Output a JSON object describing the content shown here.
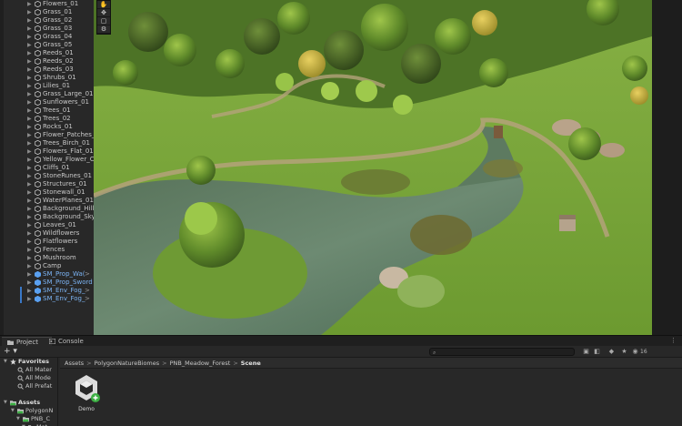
{
  "hierarchy": {
    "items": [
      {
        "label": "Flowers_01",
        "kind": "normal",
        "more": ""
      },
      {
        "label": "Grass_01",
        "kind": "normal",
        "more": ""
      },
      {
        "label": "Grass_02",
        "kind": "normal",
        "more": ""
      },
      {
        "label": "Grass_03",
        "kind": "normal",
        "more": ""
      },
      {
        "label": "Grass_04",
        "kind": "normal",
        "more": ""
      },
      {
        "label": "Grass_05",
        "kind": "normal",
        "more": ""
      },
      {
        "label": "Reeds_01",
        "kind": "normal",
        "more": ""
      },
      {
        "label": "Reeds_02",
        "kind": "normal",
        "more": ""
      },
      {
        "label": "Reeds_03",
        "kind": "normal",
        "more": ""
      },
      {
        "label": "Shrubs_01",
        "kind": "normal",
        "more": ""
      },
      {
        "label": "Lilies_01",
        "kind": "normal",
        "more": ""
      },
      {
        "label": "Grass_Large_01",
        "kind": "normal",
        "more": ""
      },
      {
        "label": "Sunflowers_01",
        "kind": "normal",
        "more": ""
      },
      {
        "label": "Trees_01",
        "kind": "normal",
        "more": ""
      },
      {
        "label": "Trees_02",
        "kind": "normal",
        "more": ""
      },
      {
        "label": "Rocks_01",
        "kind": "normal",
        "more": ""
      },
      {
        "label": "Flower_Patches_",
        "kind": "normal",
        "more": ""
      },
      {
        "label": "Trees_Birch_01",
        "kind": "normal",
        "more": ""
      },
      {
        "label": "Flowers_Flat_01",
        "kind": "normal",
        "more": ""
      },
      {
        "label": "Yellow_Flower_C",
        "kind": "normal",
        "more": ""
      },
      {
        "label": "Cliffs_01",
        "kind": "normal",
        "more": ""
      },
      {
        "label": "StoneRunes_01",
        "kind": "normal",
        "more": ""
      },
      {
        "label": "Structures_01",
        "kind": "normal",
        "more": ""
      },
      {
        "label": "Stonewall_01",
        "kind": "normal",
        "more": ""
      },
      {
        "label": "WaterPlanes_01",
        "kind": "normal",
        "more": ""
      },
      {
        "label": "Background_Hill",
        "kind": "normal",
        "more": ""
      },
      {
        "label": "Background_Sky",
        "kind": "normal",
        "more": ""
      },
      {
        "label": "Leaves_01",
        "kind": "normal",
        "more": ""
      },
      {
        "label": "Wildflowers",
        "kind": "normal",
        "more": ""
      },
      {
        "label": "Flatflowers",
        "kind": "normal",
        "more": ""
      },
      {
        "label": "Fences",
        "kind": "normal",
        "more": ""
      },
      {
        "label": "Mushroom",
        "kind": "normal",
        "more": ""
      },
      {
        "label": "Camp",
        "kind": "normal",
        "more": ""
      },
      {
        "label": "SM_Prop_Wa(",
        "kind": "prefab",
        "more": ">"
      },
      {
        "label": "SM_Prop_Sword",
        "kind": "prefab",
        "more": ""
      },
      {
        "label": "SM_Env_Fog_",
        "kind": "prefab-sel",
        "more": ">"
      },
      {
        "label": "SM_Env_Fog_",
        "kind": "prefab-sel",
        "more": ">"
      }
    ]
  },
  "scene": {
    "tools": [
      "hand",
      "move",
      "rect",
      "settings"
    ]
  },
  "bottom": {
    "tabs": {
      "project": "Project",
      "console": "Console"
    },
    "tab_more": "⋮",
    "add_label": "+ ▾",
    "search_placeholder": "",
    "count": "16",
    "tree": [
      {
        "label": "Favorites",
        "kind": "header",
        "depth": 0,
        "icon": "star-icon"
      },
      {
        "label": "All Mater",
        "kind": "item",
        "depth": 1,
        "icon": "search-icon"
      },
      {
        "label": "All Mode",
        "kind": "item",
        "depth": 1,
        "icon": "search-icon"
      },
      {
        "label": "All Prefat",
        "kind": "item",
        "depth": 1,
        "icon": "search-icon"
      },
      {
        "label": "",
        "kind": "spacer",
        "depth": 0,
        "icon": ""
      },
      {
        "label": "Assets",
        "kind": "header",
        "depth": 0,
        "icon": "folder-icon"
      },
      {
        "label": "PolygonN",
        "kind": "item",
        "depth": 1,
        "icon": "folder-icon"
      },
      {
        "label": "PNB_C",
        "kind": "item",
        "depth": 2,
        "icon": "folder-icon"
      },
      {
        "label": "Mat",
        "kind": "item",
        "depth": 3,
        "icon": "folder-icon"
      }
    ],
    "breadcrumb": [
      "Assets",
      "PolygonNatureBiomes",
      "PNB_Meadow_Forest",
      "Scene"
    ],
    "breadcrumb_sep": ">",
    "asset": {
      "label": "Demo",
      "icon": "unity-scene-icon"
    }
  },
  "colors": {
    "prefab_text": "#7cb4f4",
    "panel": "#282828",
    "selection": "#3a79c8"
  }
}
